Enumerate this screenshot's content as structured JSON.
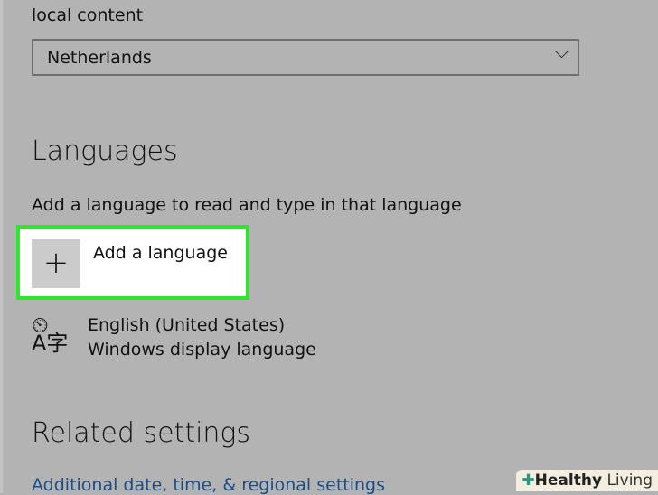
{
  "region": {
    "label": "local content",
    "selected": "Netherlands"
  },
  "languages": {
    "heading": "Languages",
    "description": "Add a language to read and type in that language",
    "add_button": "Add a language",
    "items": [
      {
        "name": "English (United States)",
        "detail": "Windows display language"
      }
    ]
  },
  "related": {
    "heading": "Related settings",
    "link": "Additional date, time, & regional settings"
  },
  "watermark": {
    "brand_bold": "Healthy",
    "brand_rest": "Living"
  }
}
